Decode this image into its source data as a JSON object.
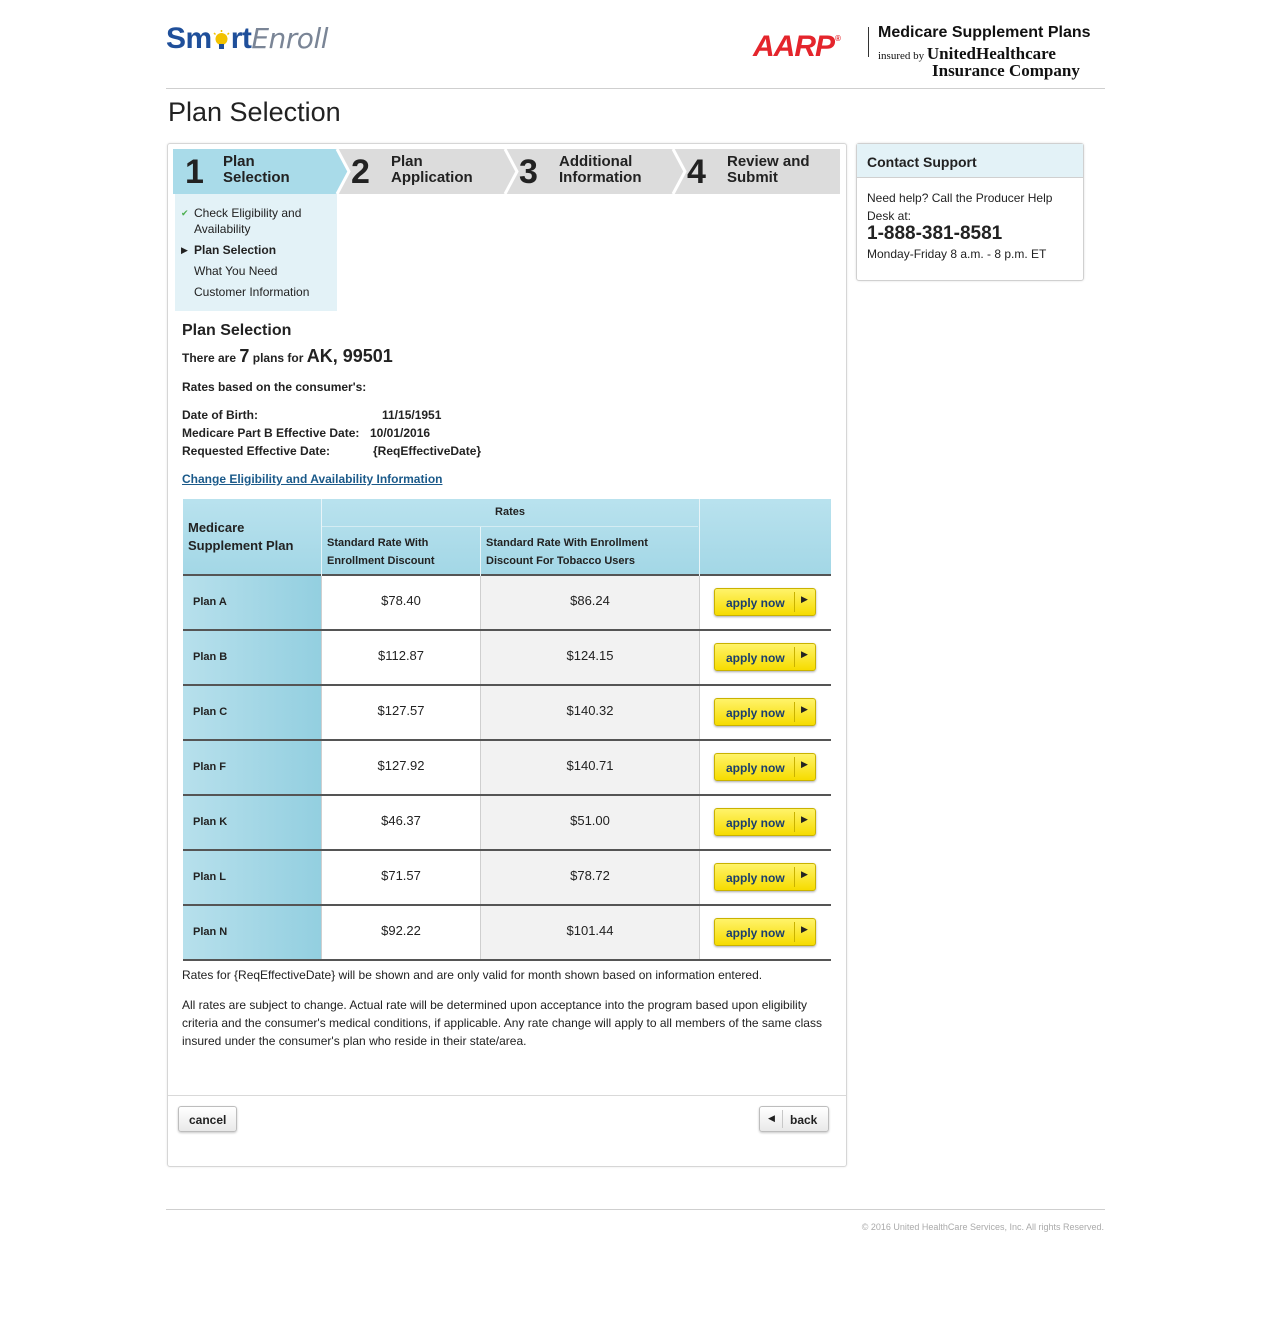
{
  "header": {
    "logo_smart": "Sm",
    "logo_rt": "rt",
    "logo_enroll": "Enroll",
    "aarp": "AARP",
    "aarp_reg": "®",
    "mss_title": "Medicare Supplement Plans",
    "insured_by": "insured by",
    "insurer_line1": "UnitedHealthcare",
    "insurer_line2": "Insurance Company"
  },
  "page_title": "Plan Selection",
  "steps": [
    {
      "num": "1",
      "label": "Plan Selection",
      "line1": "Plan",
      "line2": "Selection",
      "active": true
    },
    {
      "num": "2",
      "label": "Plan Application",
      "line1": "Plan",
      "line2": "Application",
      "active": false
    },
    {
      "num": "3",
      "label": "Additional Information",
      "line1": "Additional",
      "line2": "Information",
      "active": false
    },
    {
      "num": "4",
      "label": "Review and Submit",
      "line1": "Review and",
      "line2": "Submit",
      "active": false
    }
  ],
  "subnav": [
    {
      "line1": "Check Eligibility and",
      "line2": "Availability",
      "state": "done"
    },
    {
      "line1": "Plan Selection",
      "state": "current"
    },
    {
      "line1": "What You Need",
      "state": "pending"
    },
    {
      "line1": "Customer Information",
      "state": "pending"
    }
  ],
  "section": {
    "title": "Plan Selection",
    "count_prefix": "There are",
    "count": "7",
    "count_mid": "plans for",
    "location": "AK, 99501",
    "rates_based": "Rates based on the consumer's:",
    "dob_label": "Date of Birth:",
    "dob_value": "11/15/1951",
    "partb_label": "Medicare Part B Effective Date:",
    "partb_value": "10/01/2016",
    "req_label": "Requested Effective Date:",
    "req_value": "{ReqEffectiveDate}",
    "change_link": "Change Eligibility and Availability Information"
  },
  "table": {
    "col_plan_line1": "Medicare",
    "col_plan_line2": "Supplement Plan",
    "rates_header": "Rates",
    "col_rate1_line1": "Standard Rate With",
    "col_rate1_line2": "Enrollment Discount",
    "col_rate2_line1": "Standard Rate With Enrollment",
    "col_rate2_line2": "Discount For Tobacco Users",
    "apply_label": "apply now",
    "rows": [
      {
        "plan": "Plan A",
        "rate": "$78.40",
        "tobacco": "$86.24"
      },
      {
        "plan": "Plan B",
        "rate": "$112.87",
        "tobacco": "$124.15"
      },
      {
        "plan": "Plan C",
        "rate": "$127.57",
        "tobacco": "$140.32"
      },
      {
        "plan": "Plan F",
        "rate": "$127.92",
        "tobacco": "$140.71"
      },
      {
        "plan": "Plan K",
        "rate": "$46.37",
        "tobacco": "$51.00"
      },
      {
        "plan": "Plan L",
        "rate": "$71.57",
        "tobacco": "$78.72"
      },
      {
        "plan": "Plan N",
        "rate": "$92.22",
        "tobacco": "$101.44"
      }
    ]
  },
  "notes": {
    "note1": "Rates for {ReqEffectiveDate} will be shown and are only valid for month shown based on information entered.",
    "note2": "All rates are subject to change. Actual rate will be determined upon acceptance into the program based upon eligibility criteria and the consumer's medical conditions, if applicable. Any rate change will apply to all members of the same class insured under the consumer's plan who reside in their state/area."
  },
  "actions": {
    "cancel": "cancel",
    "back": "back"
  },
  "support": {
    "title": "Contact Support",
    "help": "Need help? Call the Producer Help Desk at:",
    "phone": "1-888-381-8581",
    "hours": "Monday-Friday 8 a.m. - 8 p.m. ET"
  },
  "footer": {
    "copyright": "© 2016 United HealthCare Services, Inc. All rights Reserved."
  },
  "colors": {
    "accent_blue": "#a3d7e6",
    "brand_blue": "#1f4f9a",
    "aarp_red": "#e4252c",
    "apply_yellow": "#f6dc00",
    "link_blue": "#1b5a8a"
  },
  "icons": {
    "logo_bulb": "lightbulb-icon",
    "done_mark": "checkmark-icon",
    "current_mark": "triangle-right-icon",
    "apply_arrow": "arrow-right-icon",
    "back_arrow": "arrow-left-icon"
  }
}
